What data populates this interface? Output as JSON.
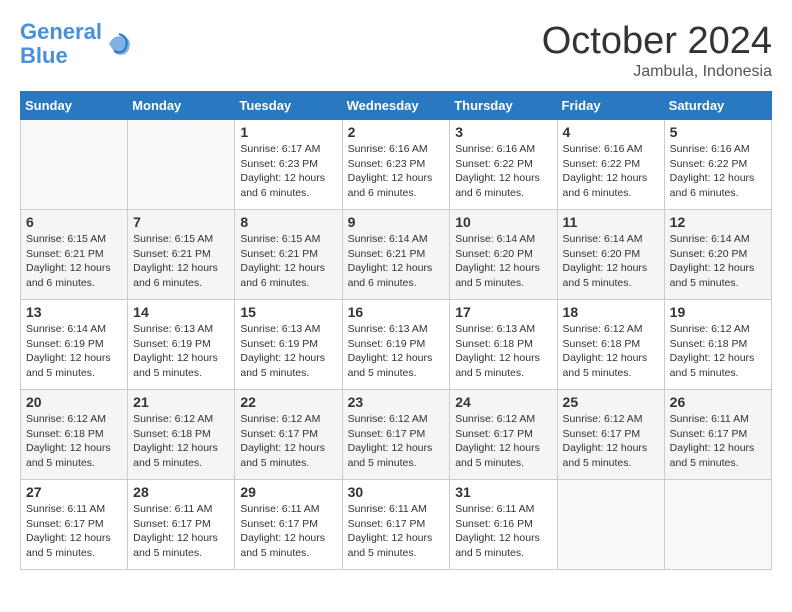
{
  "header": {
    "logo_general": "General",
    "logo_blue": "Blue",
    "month": "October 2024",
    "location": "Jambula, Indonesia"
  },
  "weekdays": [
    "Sunday",
    "Monday",
    "Tuesday",
    "Wednesday",
    "Thursday",
    "Friday",
    "Saturday"
  ],
  "weeks": [
    [
      {
        "day": "",
        "info": ""
      },
      {
        "day": "",
        "info": ""
      },
      {
        "day": "1",
        "info": "Sunrise: 6:17 AM\nSunset: 6:23 PM\nDaylight: 12 hours and 6 minutes."
      },
      {
        "day": "2",
        "info": "Sunrise: 6:16 AM\nSunset: 6:23 PM\nDaylight: 12 hours and 6 minutes."
      },
      {
        "day": "3",
        "info": "Sunrise: 6:16 AM\nSunset: 6:22 PM\nDaylight: 12 hours and 6 minutes."
      },
      {
        "day": "4",
        "info": "Sunrise: 6:16 AM\nSunset: 6:22 PM\nDaylight: 12 hours and 6 minutes."
      },
      {
        "day": "5",
        "info": "Sunrise: 6:16 AM\nSunset: 6:22 PM\nDaylight: 12 hours and 6 minutes."
      }
    ],
    [
      {
        "day": "6",
        "info": "Sunrise: 6:15 AM\nSunset: 6:21 PM\nDaylight: 12 hours and 6 minutes."
      },
      {
        "day": "7",
        "info": "Sunrise: 6:15 AM\nSunset: 6:21 PM\nDaylight: 12 hours and 6 minutes."
      },
      {
        "day": "8",
        "info": "Sunrise: 6:15 AM\nSunset: 6:21 PM\nDaylight: 12 hours and 6 minutes."
      },
      {
        "day": "9",
        "info": "Sunrise: 6:14 AM\nSunset: 6:21 PM\nDaylight: 12 hours and 6 minutes."
      },
      {
        "day": "10",
        "info": "Sunrise: 6:14 AM\nSunset: 6:20 PM\nDaylight: 12 hours and 5 minutes."
      },
      {
        "day": "11",
        "info": "Sunrise: 6:14 AM\nSunset: 6:20 PM\nDaylight: 12 hours and 5 minutes."
      },
      {
        "day": "12",
        "info": "Sunrise: 6:14 AM\nSunset: 6:20 PM\nDaylight: 12 hours and 5 minutes."
      }
    ],
    [
      {
        "day": "13",
        "info": "Sunrise: 6:14 AM\nSunset: 6:19 PM\nDaylight: 12 hours and 5 minutes."
      },
      {
        "day": "14",
        "info": "Sunrise: 6:13 AM\nSunset: 6:19 PM\nDaylight: 12 hours and 5 minutes."
      },
      {
        "day": "15",
        "info": "Sunrise: 6:13 AM\nSunset: 6:19 PM\nDaylight: 12 hours and 5 minutes."
      },
      {
        "day": "16",
        "info": "Sunrise: 6:13 AM\nSunset: 6:19 PM\nDaylight: 12 hours and 5 minutes."
      },
      {
        "day": "17",
        "info": "Sunrise: 6:13 AM\nSunset: 6:18 PM\nDaylight: 12 hours and 5 minutes."
      },
      {
        "day": "18",
        "info": "Sunrise: 6:12 AM\nSunset: 6:18 PM\nDaylight: 12 hours and 5 minutes."
      },
      {
        "day": "19",
        "info": "Sunrise: 6:12 AM\nSunset: 6:18 PM\nDaylight: 12 hours and 5 minutes."
      }
    ],
    [
      {
        "day": "20",
        "info": "Sunrise: 6:12 AM\nSunset: 6:18 PM\nDaylight: 12 hours and 5 minutes."
      },
      {
        "day": "21",
        "info": "Sunrise: 6:12 AM\nSunset: 6:18 PM\nDaylight: 12 hours and 5 minutes."
      },
      {
        "day": "22",
        "info": "Sunrise: 6:12 AM\nSunset: 6:17 PM\nDaylight: 12 hours and 5 minutes."
      },
      {
        "day": "23",
        "info": "Sunrise: 6:12 AM\nSunset: 6:17 PM\nDaylight: 12 hours and 5 minutes."
      },
      {
        "day": "24",
        "info": "Sunrise: 6:12 AM\nSunset: 6:17 PM\nDaylight: 12 hours and 5 minutes."
      },
      {
        "day": "25",
        "info": "Sunrise: 6:12 AM\nSunset: 6:17 PM\nDaylight: 12 hours and 5 minutes."
      },
      {
        "day": "26",
        "info": "Sunrise: 6:11 AM\nSunset: 6:17 PM\nDaylight: 12 hours and 5 minutes."
      }
    ],
    [
      {
        "day": "27",
        "info": "Sunrise: 6:11 AM\nSunset: 6:17 PM\nDaylight: 12 hours and 5 minutes."
      },
      {
        "day": "28",
        "info": "Sunrise: 6:11 AM\nSunset: 6:17 PM\nDaylight: 12 hours and 5 minutes."
      },
      {
        "day": "29",
        "info": "Sunrise: 6:11 AM\nSunset: 6:17 PM\nDaylight: 12 hours and 5 minutes."
      },
      {
        "day": "30",
        "info": "Sunrise: 6:11 AM\nSunset: 6:17 PM\nDaylight: 12 hours and 5 minutes."
      },
      {
        "day": "31",
        "info": "Sunrise: 6:11 AM\nSunset: 6:16 PM\nDaylight: 12 hours and 5 minutes."
      },
      {
        "day": "",
        "info": ""
      },
      {
        "day": "",
        "info": ""
      }
    ]
  ]
}
